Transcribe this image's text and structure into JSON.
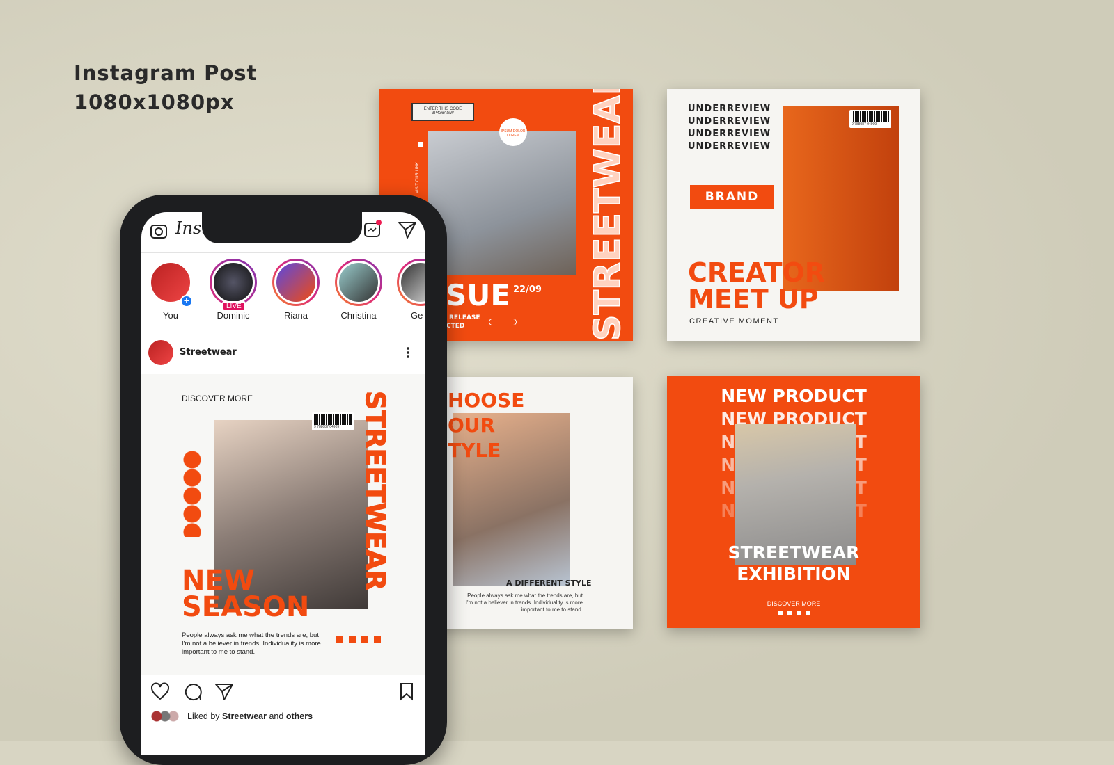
{
  "heading": {
    "line1": "Instagram Post",
    "line2": "1080x1080px"
  },
  "colors": {
    "accent": "#f24b10",
    "background": "#d8d5c3",
    "live": "#e0115f",
    "add": "#1877f2"
  },
  "card_issue": {
    "code_label": "ENTER THIS CODE",
    "code_value": "3P436AGW",
    "badge": "IPSUM DOLOR LOREM",
    "side_link": "VISIT OUR LINK",
    "headline": "SUE",
    "date": "22/09",
    "sub1": "RELEASE",
    "sub2": "CTED",
    "vertical": "STREETWEAR"
  },
  "card_creator": {
    "repeat": [
      "UNDERREVIEW",
      "UNDERREVIEW",
      "UNDERREVIEW",
      "UNDERREVIEW"
    ],
    "button": "BRAND",
    "headline1": "CREATOR",
    "headline2": "MEET UP",
    "caption": "CREATIVE MOMENT",
    "barcode": "9 788087 04909"
  },
  "card_style": {
    "headline": [
      "HOOSE",
      "OUR",
      "TYLE"
    ],
    "subtitle": "A DIFFERENT STYLE",
    "body": "People always ask me what the trends are, but I'm not a believer in trends. Individuality is more important to me to stand."
  },
  "card_product": {
    "repeat": [
      "NEW PRODUCT",
      "NEW PRODUCT",
      "NEW PRODUCT",
      "NEW PRODUCT",
      "NEW PRODUCT",
      "NEW PRODUCT"
    ],
    "headline1": "STREETWEAR",
    "headline2": "EXHIBITION",
    "link": "DISCOVER MORE"
  },
  "instagram": {
    "logo": "Instagram",
    "stories": [
      {
        "name": "You"
      },
      {
        "name": "Dominic",
        "badge": "LIVE"
      },
      {
        "name": "Riana"
      },
      {
        "name": "Christina"
      },
      {
        "name": "Ge"
      }
    ],
    "post": {
      "user": "Streetwear",
      "discover": "DISCOVER MORE",
      "vertical": "STREETWEAR",
      "headline1": "NEW",
      "headline2": "SEASON",
      "body": "People always ask me what the trends are, but I'm not a believer in trends. Individuality is more important to me to stand.",
      "barcode": "9 788087 04909"
    },
    "likes": {
      "prefix": "Liked by",
      "user": "Streetwear",
      "mid": "and",
      "rest": "others"
    }
  }
}
